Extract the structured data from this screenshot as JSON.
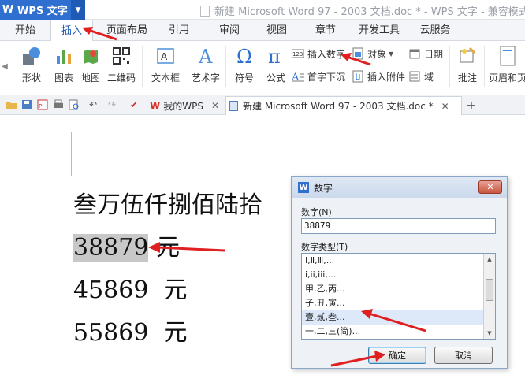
{
  "app": {
    "name": "WPS 文字",
    "logo": "W"
  },
  "window_title": "新建 Microsoft Word 97 - 2003 文档.doc * - WPS 文字 - 兼容模式",
  "menu_tabs": [
    "开始",
    "插入",
    "页面布局",
    "引用",
    "审阅",
    "视图",
    "章节",
    "开发工具",
    "云服务"
  ],
  "active_tab": "插入",
  "ribbon": {
    "large_buttons": [
      "形状",
      "图表",
      "地图",
      "二维码",
      "文本框",
      "艺术字",
      "符号",
      "公式",
      "批注",
      "页眉和页"
    ],
    "small_buttons": {
      "insert_number": "插入数字",
      "object": "对象",
      "date": "日期",
      "drop_cap": "首字下沉",
      "attachment": "插入附件",
      "field": "域"
    }
  },
  "doc_tabs": {
    "my_wps": "我的WPS",
    "current": "新建 Microsoft Word 97 - 2003 文档.doc *"
  },
  "document": {
    "line1": "叁万伍仟捌佰陆拾",
    "line2_number": "38879",
    "line2_unit": " 元",
    "line3": "45869  元",
    "line4": "55869  元"
  },
  "dialog": {
    "title": "数字",
    "number_label": "数字(N)",
    "number_value": "38879",
    "type_label": "数字类型(T)",
    "types": [
      "Ⅰ,Ⅱ,Ⅲ,...",
      "i,ii,iii,...",
      "甲,乙,丙...",
      "子,丑,寅...",
      "壹,贰,叁...",
      "一,二,三(简)..."
    ],
    "selected_index": 4,
    "ok": "确定",
    "cancel": "取消"
  },
  "colors": {
    "accent": "#2e6fcf",
    "annotation": "#e02020"
  }
}
